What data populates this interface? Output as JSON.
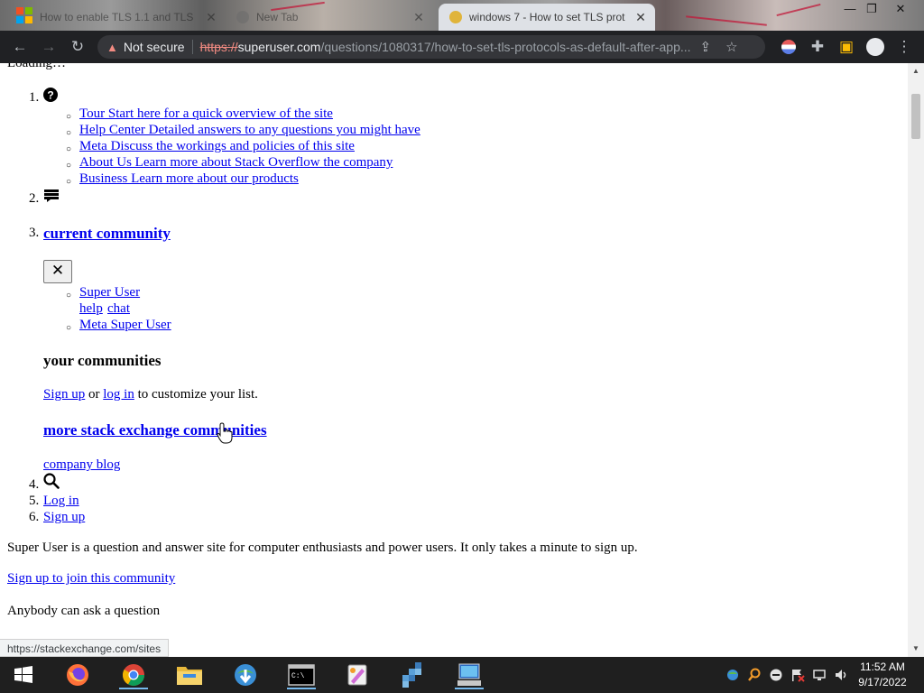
{
  "browser": {
    "tabs": [
      {
        "title": "How to enable TLS 1.1 and TLS",
        "state": "inactive"
      },
      {
        "title": "New Tab",
        "state": "inactive"
      },
      {
        "title": "windows 7 - How to set TLS prot",
        "state": "active"
      }
    ],
    "security_label": "Not secure",
    "url_scheme": "https://",
    "url_host": "superuser.com",
    "url_path": "/questions/1080317/how-to-set-tls-protocols-as-default-after-app...",
    "status_url": "https://stackexchange.com/sites"
  },
  "page": {
    "loading_text": "Loading…",
    "nav_numbers": [
      "1.",
      "2.",
      "3.",
      "4.",
      "5.",
      "6."
    ],
    "help_links": [
      "Tour Start here for a quick overview of the site",
      "Help Center Detailed answers to any questions you might have",
      "Meta Discuss the workings and policies of this site",
      "About Us Learn more about Stack Overflow the company",
      "Business Learn more about our products"
    ],
    "current_community": "current community",
    "close_glyph": "✕",
    "community_site": "Super User",
    "community_help": "help",
    "community_chat": "chat",
    "community_meta": "Meta Super User",
    "your_communities": "your communities",
    "signup_link": "Sign up",
    "or_text": "or",
    "login_link": "log in",
    "customize_text": "to customize your list.",
    "more_communities": "more stack exchange communities",
    "company_blog": "company blog",
    "log_in": "Log in",
    "sign_up": "Sign up",
    "site_description": "Super User is a question and answer site for computer enthusiasts and power users. It only takes a minute to sign up.",
    "join_link": "Sign up to join this community",
    "anybody_text": "Anybody can ask a question"
  },
  "taskbar": {
    "time": "11:52 AM",
    "date": "9/17/2022"
  },
  "colors": {
    "link": "#0000ee",
    "toolbar": "#202124",
    "taskbar": "#1f1f1f",
    "not_secure": "#f28b82"
  }
}
